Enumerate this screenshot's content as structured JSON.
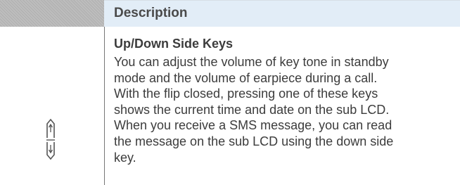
{
  "header": {
    "column_label": "Description"
  },
  "row": {
    "icon": "up-down-side-keys-icon",
    "title": "Up/Down Side Keys",
    "description_lines": [
      "You can adjust the volume of key tone in standby",
      "mode and the volume of earpiece during a call.",
      "With the flip closed, pressing one of these keys",
      "shows the current time and date on the sub LCD.",
      "When you receive a SMS message, you can read",
      "the message on the sub LCD using the down side",
      "key."
    ]
  },
  "colors": {
    "header_left": "#b4b4b4",
    "header_right": "#e2edf7",
    "text": "#3c3c3c",
    "divider": "#777777"
  }
}
